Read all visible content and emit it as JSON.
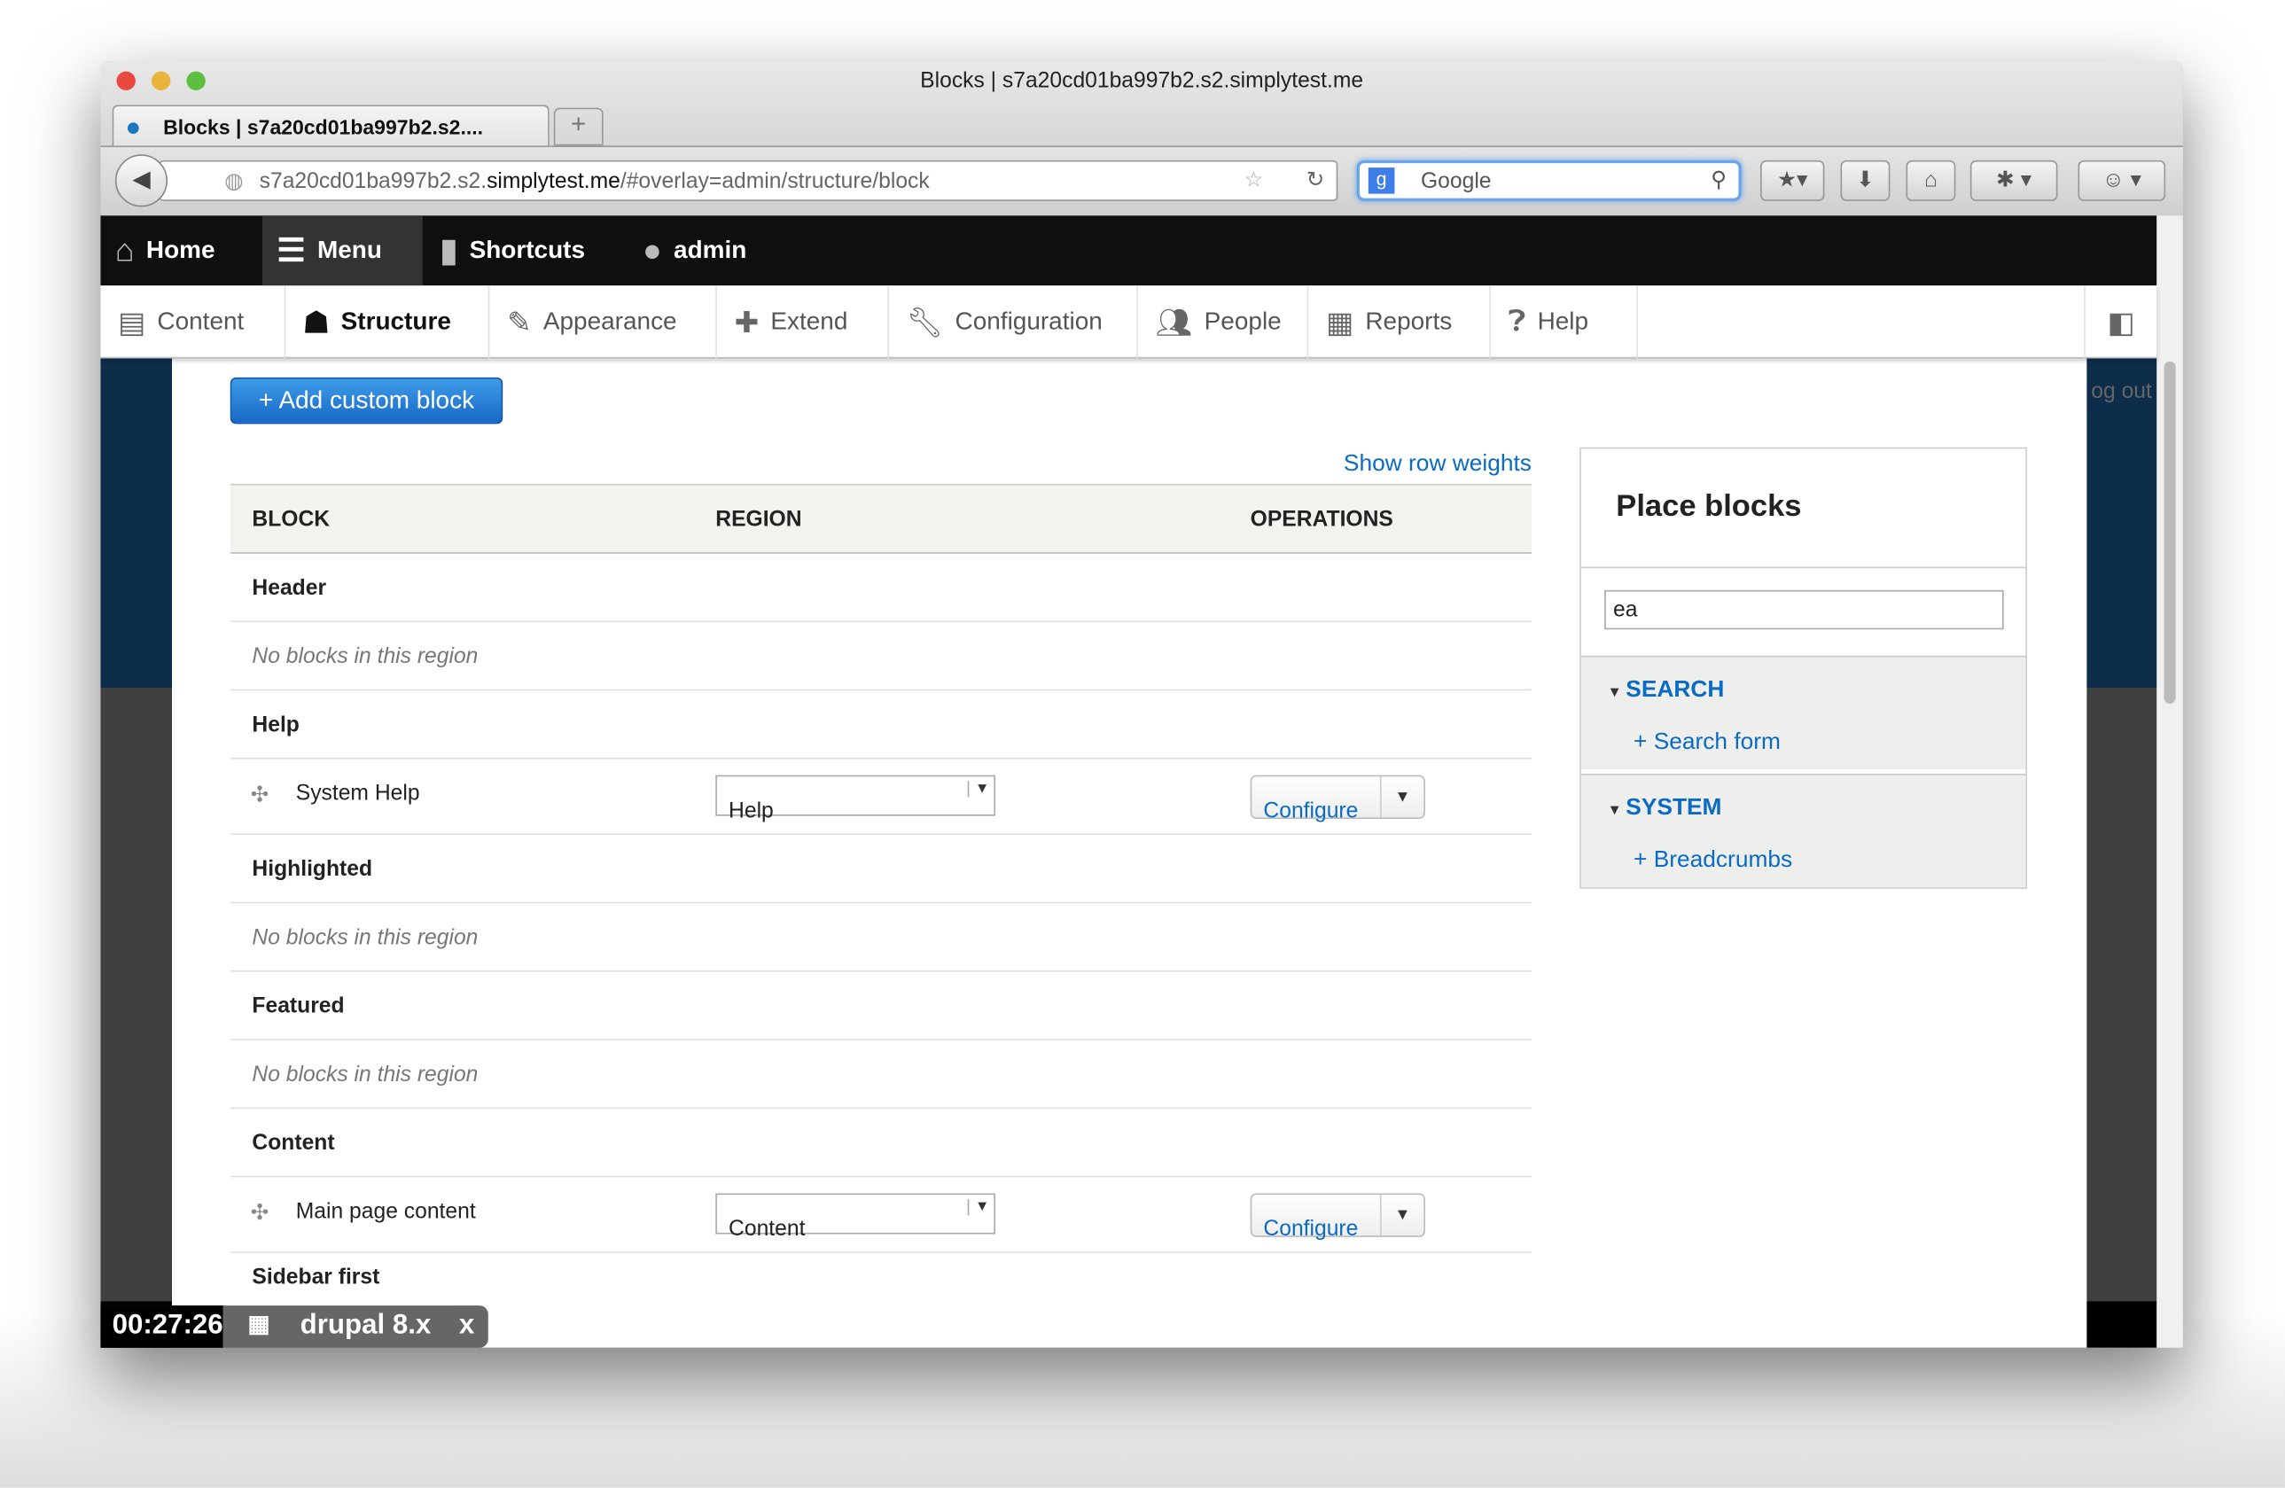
{
  "window": {
    "title": "Blocks | s7a20cd01ba997b2.s2.simplytest.me"
  },
  "tab": {
    "label": "Blocks | s7a20cd01ba997b2.s2...."
  },
  "url": {
    "prefix": "s7a20cd01ba997b2.s2.",
    "domain": "simplytest.me",
    "path": "/#overlay=admin/structure/block"
  },
  "search": {
    "placeholder": "Google"
  },
  "toolbar": {
    "items": [
      {
        "label": "Home",
        "icon": "home-icon"
      },
      {
        "label": "Menu",
        "icon": "menu-icon"
      },
      {
        "label": "Shortcuts",
        "icon": "bookmark-icon"
      },
      {
        "label": "admin",
        "icon": "user-icon"
      }
    ]
  },
  "tray": {
    "items": [
      {
        "label": "Content",
        "icon": "document-icon"
      },
      {
        "label": "Structure",
        "icon": "sitemap-icon",
        "active": true
      },
      {
        "label": "Appearance",
        "icon": "paintbrush-icon"
      },
      {
        "label": "Extend",
        "icon": "puzzle-icon"
      },
      {
        "label": "Configuration",
        "icon": "wrench-icon"
      },
      {
        "label": "People",
        "icon": "people-icon"
      },
      {
        "label": "Reports",
        "icon": "reports-icon"
      },
      {
        "label": "Help",
        "icon": "help-icon"
      }
    ]
  },
  "background": {
    "logout": "og out"
  },
  "main": {
    "add_button": "+ Add custom block",
    "show_weights": "Show row weights",
    "columns": [
      "BLOCK",
      "REGION",
      "OPERATIONS"
    ],
    "rows": [
      {
        "type": "region",
        "label": "Header"
      },
      {
        "type": "empty",
        "label": "No blocks in this region"
      },
      {
        "type": "region",
        "label": "Help"
      },
      {
        "type": "block",
        "label": "System Help",
        "region": "Help",
        "op": "Configure"
      },
      {
        "type": "region",
        "label": "Highlighted"
      },
      {
        "type": "empty",
        "label": "No blocks in this region"
      },
      {
        "type": "region",
        "label": "Featured"
      },
      {
        "type": "empty",
        "label": "No blocks in this region"
      },
      {
        "type": "region",
        "label": "Content"
      },
      {
        "type": "block",
        "label": "Main page content",
        "region": "Content",
        "op": "Configure"
      }
    ],
    "partial_row": "Sidebar first"
  },
  "place_blocks": {
    "title": "Place blocks",
    "filter_value": "ea",
    "sections": [
      {
        "label": "SEARCH",
        "item": "+ Search form"
      },
      {
        "label": "SYSTEM",
        "item": "+ Breadcrumbs"
      }
    ]
  },
  "timer": {
    "time": "00:27:26",
    "label": "drupal 8.x",
    "close": "x"
  },
  "colors": {
    "accent": "#0a6bc4",
    "toolbar": "#0f0f0f"
  }
}
